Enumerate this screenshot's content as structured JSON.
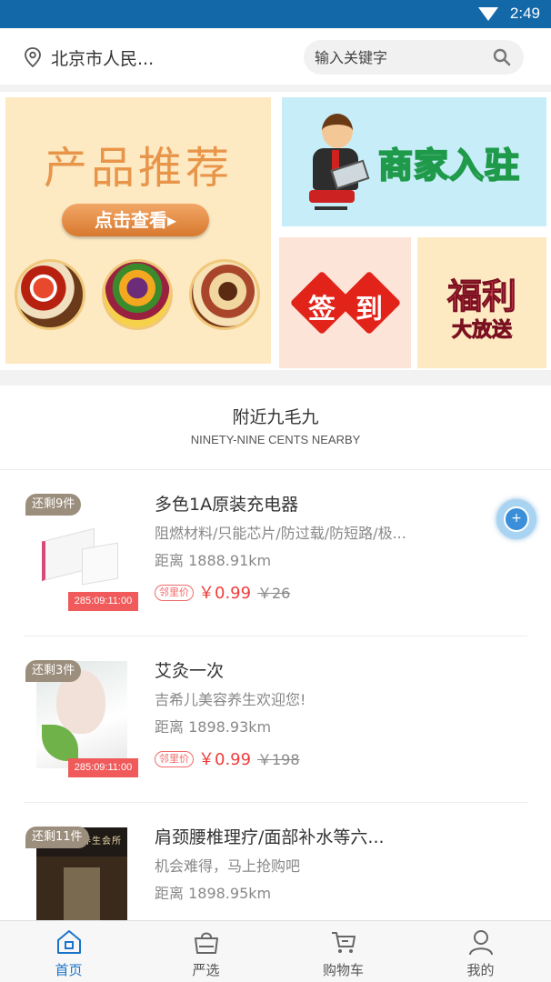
{
  "status_bar": {
    "time": "2:49"
  },
  "header": {
    "location": "北京市人民...",
    "search_placeholder": "输入关键字"
  },
  "banners": {
    "recommend": {
      "title": "产品推荐",
      "button": "点击查看▸"
    },
    "join": {
      "title": "商家入驻"
    },
    "sign": {
      "char1": "签",
      "char2": "到"
    },
    "welfare": {
      "line1": "福利",
      "line2": "大放送"
    }
  },
  "section": {
    "title": "附近九毛九",
    "subtitle": "NINETY-NINE CENTS NEARBY"
  },
  "products": [
    {
      "badge": "还剩9件",
      "timer": "285:09:11:00",
      "title": "多色1A原装充电器",
      "desc": "阻燃材料/只能芯片/防过载/防短路/极...",
      "distance": "距离 1888.91km",
      "tag": "邻里价",
      "price": "￥0.99",
      "original_price": "￥26"
    },
    {
      "badge": "还剩3件",
      "timer": "285:09:11:00",
      "title": "艾灸一次",
      "desc": "吉希儿美容养生欢迎您!",
      "distance": "距离 1898.93km",
      "tag": "邻里价",
      "price": "￥0.99",
      "original_price": "￥198"
    },
    {
      "badge": "还剩11件",
      "title": "肩颈腰椎理疗/面部补水等六...",
      "desc": "机会难得，马上抢购吧",
      "distance": "距离 1898.95km",
      "shop_sign": "恩妍养容养生会所"
    }
  ],
  "tabs": [
    {
      "label": "首页",
      "icon": "home-icon"
    },
    {
      "label": "严选",
      "icon": "bag-icon"
    },
    {
      "label": "购物车",
      "icon": "cart-icon"
    },
    {
      "label": "我的",
      "icon": "user-icon"
    }
  ],
  "colors": {
    "status_bar": "#1368a8",
    "accent": "#1a73c9",
    "price": "#f03c3c",
    "timer": "#f05a5a"
  }
}
